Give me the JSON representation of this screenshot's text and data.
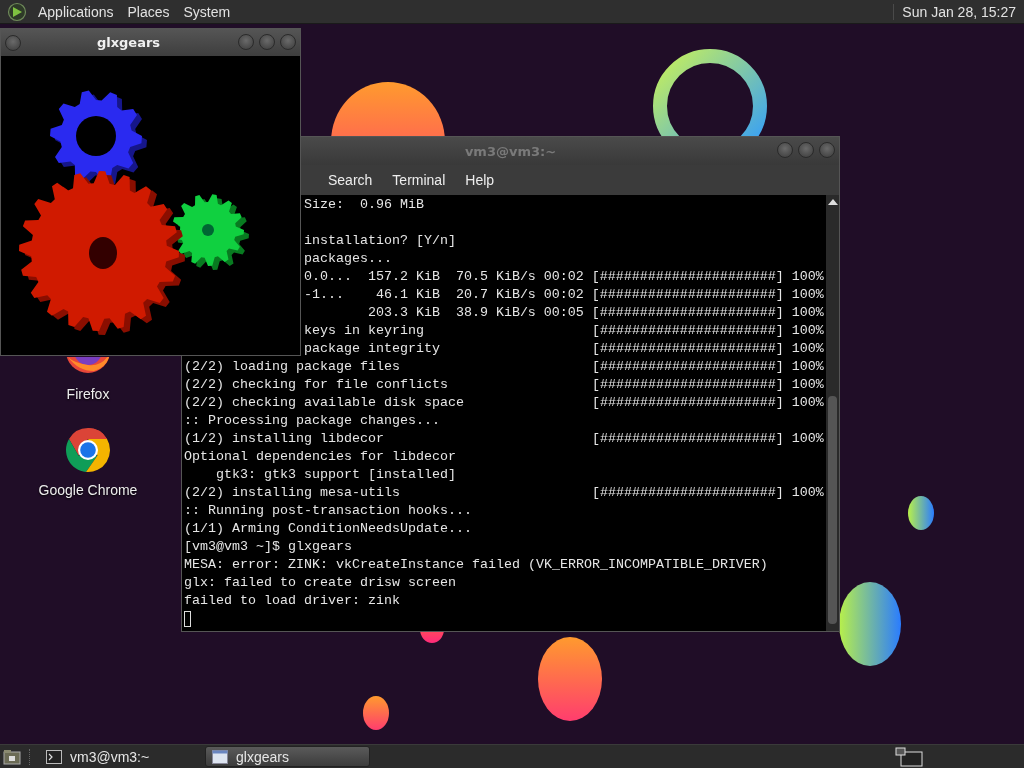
{
  "top_panel": {
    "menus": [
      "Applications",
      "Places",
      "System"
    ],
    "clock": "Sun Jan 28, 15:27"
  },
  "desktop_icons": [
    {
      "label": "Firefox",
      "kind": "firefox"
    },
    {
      "label": "Google Chrome",
      "kind": "chrome"
    }
  ],
  "glxgears_window": {
    "title": "glxgears"
  },
  "terminal_window": {
    "title": "vm3@vm3:~",
    "menus": [
      "Search",
      "Terminal",
      "Help"
    ],
    "lines": [
      {
        "kind": "text",
        "covered": true,
        "text": "Size:  0.96 MiB"
      },
      {
        "kind": "blank"
      },
      {
        "kind": "text",
        "covered": true,
        "text": "installation? [Y/n]"
      },
      {
        "kind": "text",
        "covered": true,
        "text": "packages..."
      },
      {
        "kind": "download",
        "covered": true,
        "name": "0.0...",
        "size": "157.2 KiB",
        "rate": "70.5 KiB/s",
        "time": "00:02",
        "bar": "[######################]",
        "percent": "100%"
      },
      {
        "kind": "download",
        "covered": true,
        "name": "-1...",
        "size": "46.1 KiB",
        "rate": "20.7 KiB/s",
        "time": "00:02",
        "bar": "[######################]",
        "percent": "100%"
      },
      {
        "kind": "download",
        "covered": true,
        "size": "203.3 KiB",
        "rate": "38.9 KiB/s",
        "time": "00:05",
        "bar": "[######################]",
        "percent": "100%"
      },
      {
        "kind": "text",
        "covered": true,
        "text": "keys in keyring",
        "bar": "[######################]",
        "percent": "100%"
      },
      {
        "kind": "text",
        "covered": true,
        "text": "package integrity",
        "bar": "[######################]",
        "percent": "100%"
      },
      {
        "kind": "text",
        "covered": false,
        "text": "(2/2) loading package files",
        "bar": "[######################]",
        "percent": "100%"
      },
      {
        "kind": "text",
        "covered": false,
        "text": "(2/2) checking for file conflicts",
        "bar": "[######################]",
        "percent": "100%"
      },
      {
        "kind": "text",
        "covered": false,
        "text": "(2/2) checking available disk space",
        "bar": "[######################]",
        "percent": "100%"
      },
      {
        "kind": "text",
        "covered": false,
        "text": ":: Processing package changes..."
      },
      {
        "kind": "text",
        "covered": false,
        "text": "(1/2) installing libdecor",
        "bar": "[######################]",
        "percent": "100%"
      },
      {
        "kind": "text",
        "covered": false,
        "text": "Optional dependencies for libdecor"
      },
      {
        "kind": "sub",
        "covered": false,
        "text": "gtk3: gtk3 support [installed]"
      },
      {
        "kind": "text",
        "covered": false,
        "text": "(2/2) installing mesa-utils",
        "bar": "[######################]",
        "percent": "100%"
      },
      {
        "kind": "text",
        "covered": false,
        "text": ":: Running post-transaction hooks..."
      },
      {
        "kind": "text",
        "covered": false,
        "text": "(1/1) Arming ConditionNeedsUpdate..."
      },
      {
        "kind": "text",
        "covered": false,
        "text": "[vm3@vm3 ~]$ glxgears"
      },
      {
        "kind": "text",
        "covered": false,
        "text": "MESA: error: ZINK: vkCreateInstance failed (VK_ERROR_INCOMPATIBLE_DRIVER)"
      },
      {
        "kind": "text",
        "covered": false,
        "text": "glx: failed to create drisw screen"
      },
      {
        "kind": "text",
        "covered": false,
        "text": "failed to load driver: zink"
      },
      {
        "kind": "cursor"
      }
    ]
  },
  "taskbar": {
    "tasks": [
      {
        "label": "vm3@vm3:~",
        "kind": "terminal",
        "selected": false
      },
      {
        "label": "glxgears",
        "kind": "window",
        "selected": true
      }
    ]
  }
}
